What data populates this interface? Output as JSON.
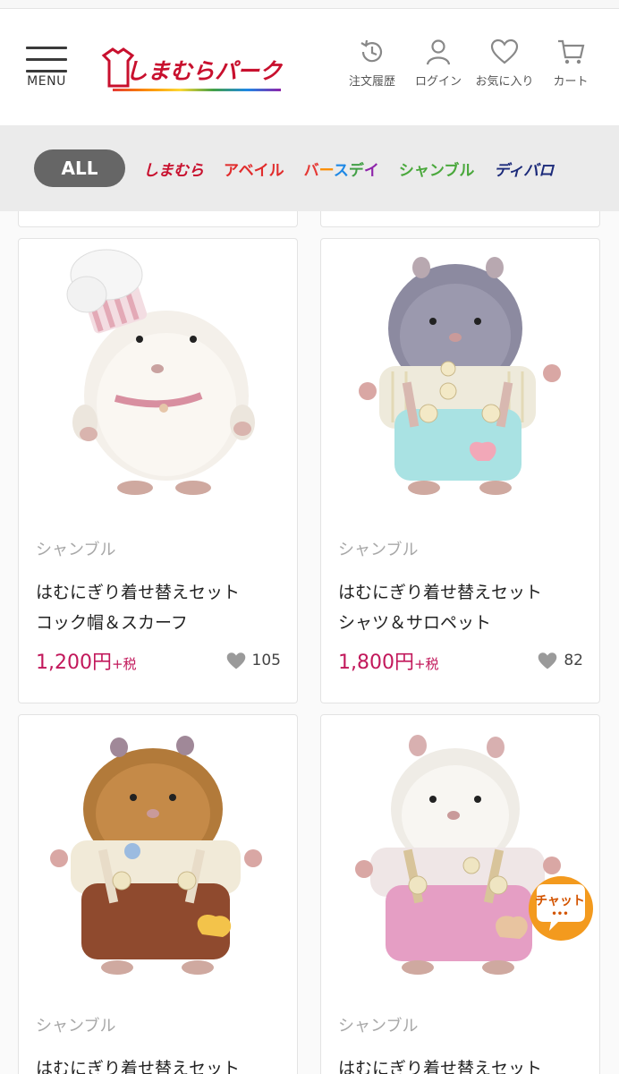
{
  "header": {
    "menu_label": "MENU",
    "logo_text": "しまむらパーク",
    "icons": [
      {
        "name": "history-icon",
        "label": "注文履歴"
      },
      {
        "name": "user-icon",
        "label": "ログイン"
      },
      {
        "name": "heart-icon",
        "label": "お気に入り"
      },
      {
        "name": "cart-icon",
        "label": "カート"
      }
    ]
  },
  "brand_filter": {
    "all_label": "ALL",
    "brands": [
      "しまむら",
      "アベイル",
      "バースデイ",
      "シャンブル",
      "ディバロ"
    ]
  },
  "products": [
    {
      "brand": "シャンブル",
      "title_line1": "はむにぎり着せ替えセット",
      "title_line2": "コック帽＆スカーフ",
      "price": "1,200円",
      "tax": "+税",
      "favorites": "105"
    },
    {
      "brand": "シャンブル",
      "title_line1": "はむにぎり着せ替えセット",
      "title_line2": "シャツ＆サロペット",
      "price": "1,800円",
      "tax": "+税",
      "favorites": "82"
    },
    {
      "brand": "シャンブル",
      "title_line1": "はむにぎり着せ替えセット",
      "title_line2": "",
      "price": "",
      "tax": "",
      "favorites": ""
    },
    {
      "brand": "シャンブル",
      "title_line1": "はむにぎり着せ替えセット",
      "title_line2": "",
      "price": "",
      "tax": "",
      "favorites": ""
    }
  ],
  "chat": {
    "label": "チャット",
    "dots": "•••"
  },
  "colors": {
    "brand_red": "#c8102e",
    "price": "#c2185b",
    "shamble_green": "#4aa83c",
    "divalo_navy": "#1b2a7a"
  }
}
